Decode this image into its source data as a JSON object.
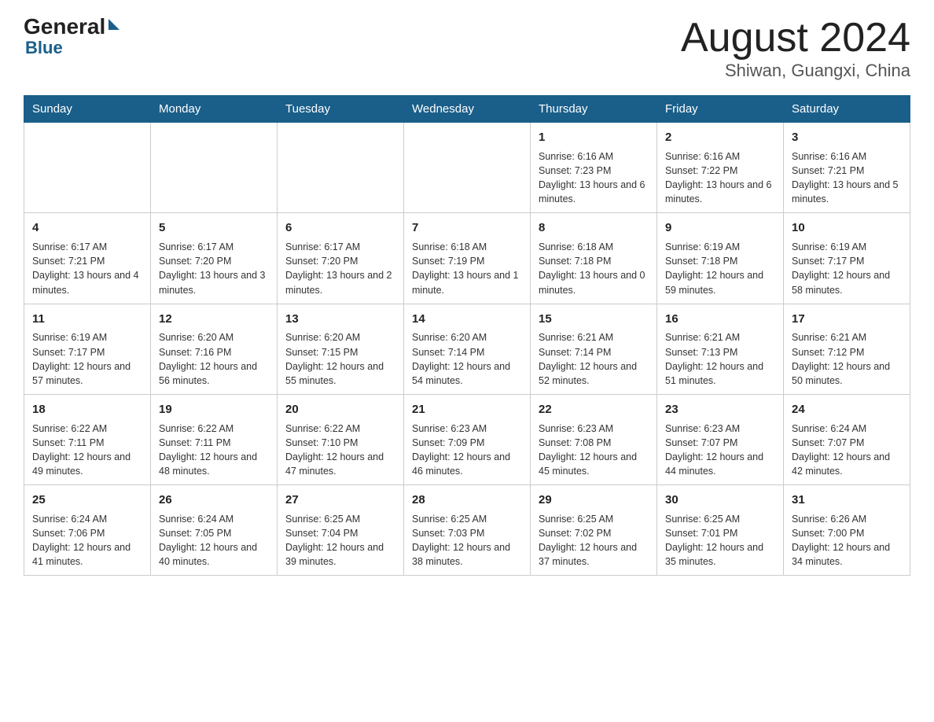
{
  "header": {
    "logo_general": "General",
    "logo_blue": "Blue",
    "month_year": "August 2024",
    "location": "Shiwan, Guangxi, China"
  },
  "days_of_week": [
    "Sunday",
    "Monday",
    "Tuesday",
    "Wednesday",
    "Thursday",
    "Friday",
    "Saturday"
  ],
  "weeks": [
    [
      {
        "day": "",
        "info": ""
      },
      {
        "day": "",
        "info": ""
      },
      {
        "day": "",
        "info": ""
      },
      {
        "day": "",
        "info": ""
      },
      {
        "day": "1",
        "info": "Sunrise: 6:16 AM\nSunset: 7:23 PM\nDaylight: 13 hours and 6 minutes."
      },
      {
        "day": "2",
        "info": "Sunrise: 6:16 AM\nSunset: 7:22 PM\nDaylight: 13 hours and 6 minutes."
      },
      {
        "day": "3",
        "info": "Sunrise: 6:16 AM\nSunset: 7:21 PM\nDaylight: 13 hours and 5 minutes."
      }
    ],
    [
      {
        "day": "4",
        "info": "Sunrise: 6:17 AM\nSunset: 7:21 PM\nDaylight: 13 hours and 4 minutes."
      },
      {
        "day": "5",
        "info": "Sunrise: 6:17 AM\nSunset: 7:20 PM\nDaylight: 13 hours and 3 minutes."
      },
      {
        "day": "6",
        "info": "Sunrise: 6:17 AM\nSunset: 7:20 PM\nDaylight: 13 hours and 2 minutes."
      },
      {
        "day": "7",
        "info": "Sunrise: 6:18 AM\nSunset: 7:19 PM\nDaylight: 13 hours and 1 minute."
      },
      {
        "day": "8",
        "info": "Sunrise: 6:18 AM\nSunset: 7:18 PM\nDaylight: 13 hours and 0 minutes."
      },
      {
        "day": "9",
        "info": "Sunrise: 6:19 AM\nSunset: 7:18 PM\nDaylight: 12 hours and 59 minutes."
      },
      {
        "day": "10",
        "info": "Sunrise: 6:19 AM\nSunset: 7:17 PM\nDaylight: 12 hours and 58 minutes."
      }
    ],
    [
      {
        "day": "11",
        "info": "Sunrise: 6:19 AM\nSunset: 7:17 PM\nDaylight: 12 hours and 57 minutes."
      },
      {
        "day": "12",
        "info": "Sunrise: 6:20 AM\nSunset: 7:16 PM\nDaylight: 12 hours and 56 minutes."
      },
      {
        "day": "13",
        "info": "Sunrise: 6:20 AM\nSunset: 7:15 PM\nDaylight: 12 hours and 55 minutes."
      },
      {
        "day": "14",
        "info": "Sunrise: 6:20 AM\nSunset: 7:14 PM\nDaylight: 12 hours and 54 minutes."
      },
      {
        "day": "15",
        "info": "Sunrise: 6:21 AM\nSunset: 7:14 PM\nDaylight: 12 hours and 52 minutes."
      },
      {
        "day": "16",
        "info": "Sunrise: 6:21 AM\nSunset: 7:13 PM\nDaylight: 12 hours and 51 minutes."
      },
      {
        "day": "17",
        "info": "Sunrise: 6:21 AM\nSunset: 7:12 PM\nDaylight: 12 hours and 50 minutes."
      }
    ],
    [
      {
        "day": "18",
        "info": "Sunrise: 6:22 AM\nSunset: 7:11 PM\nDaylight: 12 hours and 49 minutes."
      },
      {
        "day": "19",
        "info": "Sunrise: 6:22 AM\nSunset: 7:11 PM\nDaylight: 12 hours and 48 minutes."
      },
      {
        "day": "20",
        "info": "Sunrise: 6:22 AM\nSunset: 7:10 PM\nDaylight: 12 hours and 47 minutes."
      },
      {
        "day": "21",
        "info": "Sunrise: 6:23 AM\nSunset: 7:09 PM\nDaylight: 12 hours and 46 minutes."
      },
      {
        "day": "22",
        "info": "Sunrise: 6:23 AM\nSunset: 7:08 PM\nDaylight: 12 hours and 45 minutes."
      },
      {
        "day": "23",
        "info": "Sunrise: 6:23 AM\nSunset: 7:07 PM\nDaylight: 12 hours and 44 minutes."
      },
      {
        "day": "24",
        "info": "Sunrise: 6:24 AM\nSunset: 7:07 PM\nDaylight: 12 hours and 42 minutes."
      }
    ],
    [
      {
        "day": "25",
        "info": "Sunrise: 6:24 AM\nSunset: 7:06 PM\nDaylight: 12 hours and 41 minutes."
      },
      {
        "day": "26",
        "info": "Sunrise: 6:24 AM\nSunset: 7:05 PM\nDaylight: 12 hours and 40 minutes."
      },
      {
        "day": "27",
        "info": "Sunrise: 6:25 AM\nSunset: 7:04 PM\nDaylight: 12 hours and 39 minutes."
      },
      {
        "day": "28",
        "info": "Sunrise: 6:25 AM\nSunset: 7:03 PM\nDaylight: 12 hours and 38 minutes."
      },
      {
        "day": "29",
        "info": "Sunrise: 6:25 AM\nSunset: 7:02 PM\nDaylight: 12 hours and 37 minutes."
      },
      {
        "day": "30",
        "info": "Sunrise: 6:25 AM\nSunset: 7:01 PM\nDaylight: 12 hours and 35 minutes."
      },
      {
        "day": "31",
        "info": "Sunrise: 6:26 AM\nSunset: 7:00 PM\nDaylight: 12 hours and 34 minutes."
      }
    ]
  ]
}
